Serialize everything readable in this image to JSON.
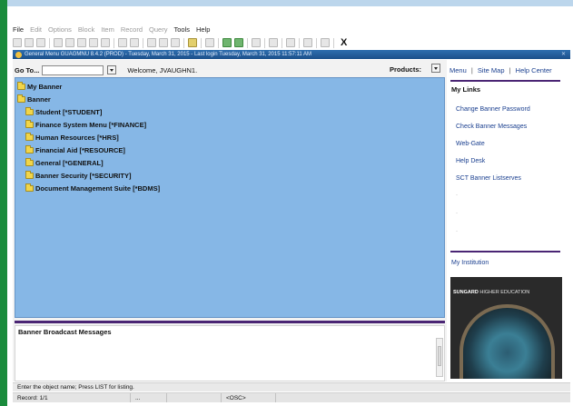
{
  "menubar": [
    "File",
    "Edit",
    "Options",
    "Block",
    "Item",
    "Record",
    "Query",
    "Tools",
    "Help"
  ],
  "window": {
    "title": "General Menu GUAGMNU 8.4.2 (PROD) - Tuesday, March 31, 2015 - Last login Tuesday, March 31, 2015 11:57:11 AM",
    "close_glyph": "X"
  },
  "goto": {
    "label": "Go To...",
    "value": ""
  },
  "welcome": "Welcome, JVAUGHN1.",
  "products_label": "Products:",
  "tree": [
    {
      "label": "My Banner"
    },
    {
      "label": "Banner"
    },
    {
      "label": "Student [*STUDENT]"
    },
    {
      "label": "Finance System Menu [*FINANCE]"
    },
    {
      "label": "Human Resources [*HRS]"
    },
    {
      "label": "Financial Aid [*RESOURCE]"
    },
    {
      "label": "General [*GENERAL]"
    },
    {
      "label": "Banner Security [*SECURITY]"
    },
    {
      "label": "Document Management Suite [*BDMS]"
    }
  ],
  "broadcast": {
    "title": "Banner Broadcast Messages"
  },
  "top_links": {
    "menu": "Menu",
    "site_map": "Site Map",
    "help_center": "Help Center",
    "sep": "|"
  },
  "my_links": {
    "title": "My Links",
    "items": [
      "Change Banner Password",
      "Check Banner Messages",
      "Web-Gate",
      "Help Desk",
      "SCT Banner Listserves"
    ]
  },
  "institution": {
    "label": "My Institution",
    "brand_bold": "SUNGARD",
    "brand_rest": " HIGHER EDUCATION"
  },
  "status": {
    "hint": "Enter the object name; Press LIST for listing.",
    "record": "Record: 1/1",
    "dots": "...",
    "osc": "<OSC>"
  },
  "colors": {
    "tree_bg": "#86b7e6",
    "accent_purple": "#4a2574",
    "title_bar": "#1b4f8a",
    "left_green": "#1a8b3c",
    "link_blue": "#1a3f8f"
  }
}
